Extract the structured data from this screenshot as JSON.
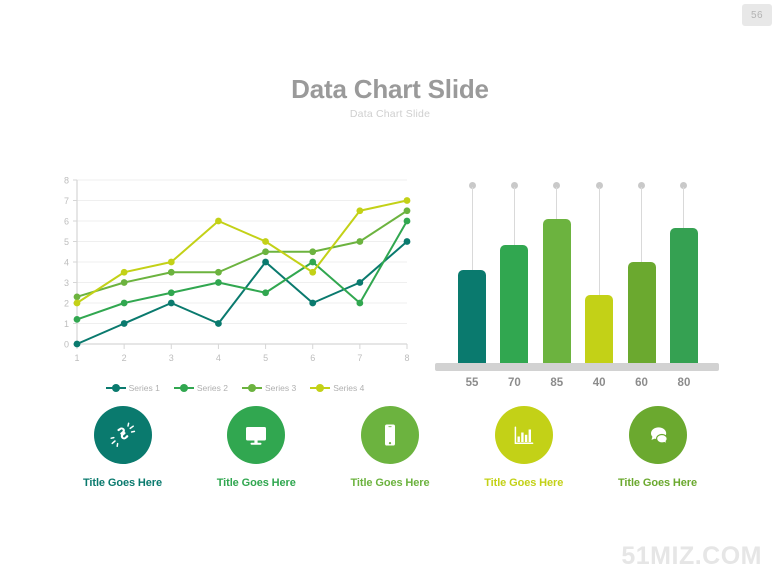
{
  "page": {
    "number": "56"
  },
  "header": {
    "title": "Data Chart Slide",
    "subtitle": "Data Chart Slide"
  },
  "watermark": {
    "text": "51MIZ.COM"
  },
  "colors": {
    "teal": "#0a7a6e",
    "green": "#31a750",
    "leaf": "#6cb33f",
    "lime": "#c3d117",
    "olive": "#6ba92f",
    "grass": "#35a152",
    "title_gray": "#9a9a9a",
    "axis_gray": "#bdbdbd"
  },
  "chart_data": [
    {
      "type": "line",
      "title": "",
      "xlabel": "",
      "ylabel": "",
      "x": [
        1,
        2,
        3,
        4,
        5,
        6,
        7,
        8
      ],
      "xticklabels": [
        "1",
        "2",
        "3",
        "4",
        "5",
        "6",
        "7",
        "8"
      ],
      "yticklabels": [
        "0",
        "1",
        "2",
        "3",
        "4",
        "5",
        "6",
        "7",
        "8"
      ],
      "ylim": [
        0,
        8
      ],
      "xlim": [
        1,
        8
      ],
      "grid": true,
      "legend": "bottom",
      "series": [
        {
          "name": "Series 1",
          "color": "#0a7a6e",
          "values": [
            0,
            1,
            2,
            1,
            4,
            2,
            3,
            5
          ]
        },
        {
          "name": "Series 2",
          "color": "#31a750",
          "values": [
            1.2,
            2,
            2.5,
            3,
            2.5,
            4,
            2,
            6
          ]
        },
        {
          "name": "Series 3",
          "color": "#6cb33f",
          "values": [
            2.3,
            3,
            3.5,
            3.5,
            4.5,
            4.5,
            5,
            6.5
          ]
        },
        {
          "name": "Series 4",
          "color": "#c3d117",
          "values": [
            2,
            3.5,
            4,
            6,
            5,
            3.5,
            6.5,
            7
          ]
        }
      ]
    },
    {
      "type": "bar",
      "title": "",
      "xlabel": "",
      "ylabel": "",
      "categories": [
        "55",
        "70",
        "85",
        "40",
        "60",
        "80"
      ],
      "values": [
        55,
        70,
        85,
        40,
        60,
        80
      ],
      "ylim": [
        0,
        100
      ],
      "grid": false,
      "bar_colors": [
        "#0a7a6e",
        "#31a750",
        "#6cb33f",
        "#c3d117",
        "#6ba92f",
        "#35a152"
      ]
    }
  ],
  "line_legend": [
    {
      "label": "Series 1",
      "color": "#0a7a6e"
    },
    {
      "label": "Series 2",
      "color": "#31a750"
    },
    {
      "label": "Series 3",
      "color": "#6cb33f"
    },
    {
      "label": "Series 4",
      "color": "#c3d117"
    }
  ],
  "bars": [
    {
      "label": "55",
      "value": 55,
      "color": "#0a7a6e"
    },
    {
      "label": "70",
      "value": 70,
      "color": "#31a750"
    },
    {
      "label": "85",
      "value": 85,
      "color": "#6cb33f"
    },
    {
      "label": "40",
      "value": 40,
      "color": "#c3d117"
    },
    {
      "label": "60",
      "value": 60,
      "color": "#6ba92f"
    },
    {
      "label": "80",
      "value": 80,
      "color": "#35a152"
    }
  ],
  "features": [
    {
      "icon": "broken-link-icon",
      "title": "Title Goes Here",
      "color": "#0a7a6e"
    },
    {
      "icon": "monitor-icon",
      "title": "Title Goes Here",
      "color": "#31a750"
    },
    {
      "icon": "smartphone-icon",
      "title": "Title Goes Here",
      "color": "#6cb33f"
    },
    {
      "icon": "bar-chart-icon",
      "title": "Title Goes Here",
      "color": "#c3d117"
    },
    {
      "icon": "speech-bubbles-icon",
      "title": "Title Goes Here",
      "color": "#6ba92f"
    }
  ]
}
